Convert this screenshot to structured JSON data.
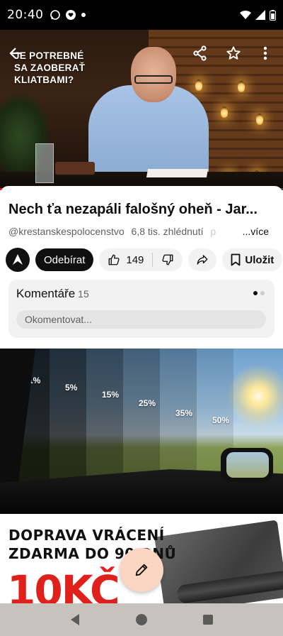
{
  "status_bar": {
    "time": "20:40"
  },
  "video": {
    "overlay_title": "JE POTREBNÉ\nSA ZAOBERAŤ\nKLIATBAMI?",
    "progress_fraction": 0.34
  },
  "info": {
    "title": "Nech ťa nezapáli falošný oheň - Jar...",
    "channel": "@krestanskespolocenstvo",
    "views": "6,8 tis. zhlédnutí",
    "truncated": "p",
    "more_label": "...více",
    "subscribe_label": "Odebírat",
    "like_count": "149",
    "save_label": "Uložit"
  },
  "comments": {
    "title": "Komentáře",
    "count": "15",
    "placeholder": "Okomentovat..."
  },
  "ad": {
    "tints": [
      "1%",
      "5%",
      "15%",
      "25%",
      "35%",
      "50%"
    ],
    "promo_line1": "DOPRAVA VRÁCENÍ",
    "promo_line2": "ZDARMA DO 90 DNŮ",
    "promo_price": "10KČ"
  },
  "colors": {
    "accent_red": "#ff0000",
    "fab_bg": "#f9d5c2",
    "price_red": "#e0201a"
  },
  "icons": [
    "back-arrow-icon",
    "share-icon",
    "star-icon",
    "more-vert-icon",
    "like-icon",
    "dislike-icon",
    "share-arrow-icon",
    "bookmark-icon",
    "pencil-icon"
  ]
}
